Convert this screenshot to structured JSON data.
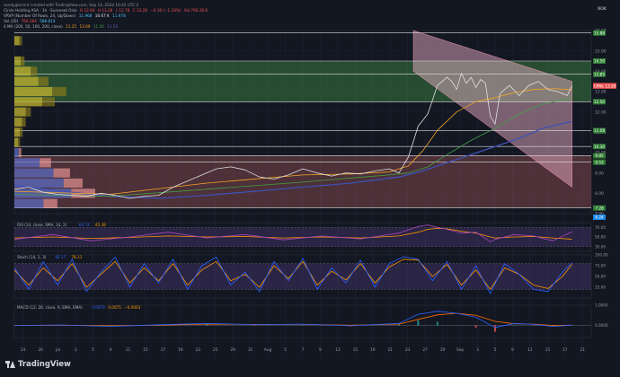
{
  "header": {
    "byline": "sandyglennnt created with TradingView.com, Sep 14, 2024 16:42 UTC-2",
    "lines": [
      {
        "name": "Circle Holding ASA · 1h · Euronext Oslo",
        "vals": [
          "O 12.84",
          "H 13.28",
          "L 12.78",
          "C 13.28",
          "−0.16 (−1.18%)",
          "Vol 760.28 K"
        ]
      },
      {
        "name": "VRVP (Number Of Rows, 24, Up/Down)",
        "vals": [
          "11.968",
          "16.67 K",
          "11.978"
        ]
      },
      {
        "name": "Vol (20)",
        "vals": [
          "760.284",
          "588.814"
        ]
      },
      {
        "name": "4 MA (200, 50, 100, 200, close)",
        "vals": [
          "11.25",
          "13.09",
          "11.56",
          "11.53"
        ]
      }
    ]
  },
  "colors": {
    "background": "#131722",
    "grid": "#1f2433",
    "up": "#26a69a",
    "down": "#ef5350",
    "green_zone": "#4caf50",
    "red_zone": "#e57373",
    "channel": "#f8bbd0",
    "ma_orange": "#f5a623",
    "ma_green": "#43a047",
    "ma_blue": "#3f51b5",
    "osc_band": "#7e57c2",
    "rsi_line": "#ab47bc",
    "signal": "#ff9800",
    "stoch_k": "#2962ff",
    "macd_line": "#2962ff",
    "macd_signal": "#ff6d00"
  },
  "chart_data": {
    "type": "line",
    "title": "Circle Holding ASA · 1h · Euronext Oslo",
    "symbol": "NOK",
    "last_price": 13.28,
    "last_price_label": "CRNL 13.28",
    "price_axis": {
      "ylim": [
        7.0,
        16.0
      ],
      "ticks": [
        "16.00",
        "15.00",
        "14.00",
        "13.00",
        "12.00",
        "11.00",
        "10.00",
        "9.00",
        "8.00",
        "7.00"
      ],
      "level_labels": [
        "15.88",
        "14.50",
        "13.85",
        "12.50",
        "11.08",
        "10.30",
        "9.85",
        "9.53",
        "7.28"
      ]
    },
    "x_axis": {
      "ticks": [
        "24",
        "26",
        "Jul",
        "3",
        "5",
        "9",
        "11",
        "15",
        "17",
        "19",
        "23",
        "25",
        "29",
        "31",
        "Aug",
        "5",
        "7",
        "9",
        "13",
        "15",
        "19",
        "21",
        "23",
        "27",
        "29",
        "Sep",
        "3",
        "5",
        "9",
        "11",
        "15",
        "17",
        "21"
      ],
      "index_range": [
        0,
        120
      ]
    },
    "green_zone": {
      "low": 12.5,
      "high": 14.5
    },
    "red_zone": {
      "low": 7.3,
      "high": 9.85
    },
    "horizontal_levels": [
      15.88,
      14.5,
      13.85,
      12.5,
      11.08,
      10.3,
      9.85,
      9.53,
      7.28
    ],
    "channel": {
      "upper": [
        {
          "x": 83,
          "y": 16.0
        },
        {
          "x": 116,
          "y": 13.5
        }
      ],
      "lower": [
        {
          "x": 83,
          "y": 14.0
        },
        {
          "x": 116,
          "y": 8.3
        }
      ]
    },
    "series": [
      {
        "name": "Close",
        "x": [
          0,
          3,
          6,
          9,
          12,
          15,
          18,
          21,
          24,
          27,
          30,
          33,
          36,
          39,
          42,
          45,
          48,
          51,
          54,
          57,
          60,
          63,
          66,
          69,
          72,
          75,
          78,
          80,
          82,
          84,
          86,
          88,
          90,
          91,
          92,
          93,
          94,
          95,
          96,
          97,
          98,
          99,
          100,
          101,
          103,
          105,
          107,
          109,
          111,
          113,
          115,
          116
        ],
        "values": [
          8.2,
          8.3,
          8.05,
          7.95,
          7.9,
          7.85,
          8.0,
          7.9,
          7.75,
          7.85,
          7.9,
          8.3,
          8.6,
          8.9,
          9.2,
          9.3,
          9.15,
          8.8,
          8.7,
          8.9,
          9.2,
          9.0,
          8.85,
          9.0,
          8.95,
          9.1,
          9.2,
          9.0,
          9.8,
          11.3,
          11.9,
          13.3,
          13.7,
          13.5,
          13.1,
          13.9,
          13.4,
          13.7,
          13.2,
          13.6,
          13.4,
          11.8,
          11.4,
          12.9,
          13.3,
          12.8,
          13.3,
          13.5,
          13.1,
          13.0,
          12.8,
          13.28
        ]
      },
      {
        "name": "MA 50",
        "x": [
          0,
          20,
          40,
          60,
          70,
          78,
          82,
          85,
          88,
          92,
          96,
          100,
          104,
          108,
          112,
          116
        ],
        "values": [
          8.1,
          7.95,
          8.5,
          8.9,
          8.95,
          9.05,
          9.35,
          10.1,
          11.1,
          12.0,
          12.5,
          12.7,
          12.95,
          13.1,
          13.15,
          13.09
        ]
      },
      {
        "name": "MA 100",
        "x": [
          0,
          20,
          40,
          60,
          70,
          78,
          82,
          86,
          90,
          95,
          100,
          105,
          110,
          116
        ],
        "values": [
          7.95,
          7.85,
          8.2,
          8.55,
          8.75,
          8.9,
          9.0,
          9.3,
          9.9,
          10.6,
          11.2,
          11.9,
          12.4,
          12.7
        ]
      },
      {
        "name": "MA 200",
        "x": [
          0,
          10,
          20,
          30,
          40,
          50,
          60,
          70,
          80,
          85,
          90,
          95,
          100,
          105,
          110,
          116
        ],
        "values": [
          8.4,
          8.1,
          7.85,
          7.75,
          7.9,
          8.1,
          8.3,
          8.5,
          8.8,
          9.1,
          9.5,
          9.9,
          10.3,
          10.7,
          11.2,
          11.53
        ]
      }
    ],
    "volume_profile": {
      "rows": [
        {
          "price": 15.5,
          "up": 8,
          "down": 4
        },
        {
          "price": 14.5,
          "up": 10,
          "down": 6
        },
        {
          "price": 14.0,
          "up": 26,
          "down": 10
        },
        {
          "price": 13.5,
          "up": 38,
          "down": 16
        },
        {
          "price": 13.0,
          "up": 60,
          "down": 22
        },
        {
          "price": 12.5,
          "up": 44,
          "down": 20
        },
        {
          "price": 12.0,
          "up": 18,
          "down": 8
        },
        {
          "price": 11.5,
          "up": 12,
          "down": 6
        },
        {
          "price": 11.0,
          "up": 9,
          "down": 4
        },
        {
          "price": 10.5,
          "up": 6,
          "down": 3
        },
        {
          "price": 10.0,
          "up": 7,
          "down": 4
        },
        {
          "price": 9.5,
          "up": 40,
          "down": 18
        },
        {
          "price": 9.0,
          "up": 62,
          "down": 26
        },
        {
          "price": 8.5,
          "up": 78,
          "down": 30
        },
        {
          "price": 8.0,
          "up": 90,
          "down": 38
        },
        {
          "price": 7.5,
          "up": 46,
          "down": 22
        }
      ]
    },
    "volume_label": "6.24",
    "panels": [
      {
        "name": "RSI",
        "header": "RSI (14, close, SMA, 14, 2)",
        "vals": [
          "60.74",
          "45.38"
        ],
        "ticks": [
          "70.00",
          "50.00",
          "30.00"
        ],
        "ylim": [
          20,
          80
        ],
        "band": [
          30,
          70
        ],
        "x": [
          0,
          8,
          16,
          24,
          32,
          40,
          48,
          56,
          64,
          72,
          80,
          84,
          86,
          88,
          90,
          93,
          96,
          99,
          100,
          104,
          108,
          112,
          116
        ],
        "values": [
          45,
          55,
          42,
          50,
          60,
          48,
          55,
          44,
          52,
          46,
          58,
          72,
          75,
          70,
          66,
          58,
          60,
          40,
          45,
          55,
          52,
          42,
          60.74
        ],
        "signal": [
          48,
          50,
          47,
          49,
          52,
          50,
          51,
          48,
          50,
          48,
          52,
          60,
          66,
          68,
          67,
          62,
          58,
          50,
          48,
          50,
          51,
          48,
          45.38
        ]
      },
      {
        "name": "Stoch",
        "header": "Stoch (14, 1, 3)",
        "vals": [
          "82.17",
          "78.11"
        ],
        "ticks": [
          "100.00",
          "75.00",
          "50.00",
          "25.00"
        ],
        "ylim": [
          0,
          100
        ],
        "band": [
          20,
          80
        ],
        "x": [
          0,
          3,
          6,
          9,
          12,
          15,
          18,
          21,
          24,
          27,
          30,
          33,
          36,
          39,
          42,
          45,
          48,
          51,
          54,
          57,
          60,
          63,
          66,
          69,
          72,
          75,
          78,
          81,
          84,
          87,
          90,
          93,
          96,
          99,
          102,
          105,
          108,
          111,
          114,
          116
        ],
        "values": [
          70,
          20,
          85,
          30,
          90,
          15,
          60,
          95,
          25,
          80,
          35,
          90,
          20,
          75,
          95,
          30,
          60,
          15,
          85,
          40,
          92,
          20,
          70,
          35,
          88,
          25,
          80,
          96,
          90,
          40,
          85,
          20,
          75,
          10,
          80,
          55,
          20,
          15,
          60,
          82.17
        ],
        "signal": [
          65,
          30,
          70,
          40,
          80,
          25,
          55,
          85,
          35,
          70,
          40,
          80,
          30,
          65,
          85,
          40,
          55,
          25,
          75,
          45,
          85,
          30,
          62,
          42,
          80,
          35,
          72,
          90,
          88,
          50,
          78,
          30,
          65,
          20,
          70,
          55,
          30,
          22,
          50,
          78.11
        ]
      },
      {
        "name": "MACD",
        "header": "MACD (12, 26, close, 9, EMA, EMA)",
        "vals": [
          "0.0079",
          "0.0075",
          "−0.0003"
        ],
        "ticks": [
          "1.0000",
          "0.0000"
        ],
        "ylim": [
          -0.6,
          1.0
        ],
        "x": [
          0,
          10,
          20,
          30,
          40,
          50,
          60,
          70,
          80,
          84,
          88,
          92,
          96,
          100,
          104,
          108,
          112,
          116
        ],
        "values": [
          0.0,
          0.02,
          -0.05,
          0.03,
          0.1,
          0.04,
          0.06,
          -0.02,
          0.1,
          0.55,
          0.7,
          0.6,
          0.4,
          -0.1,
          0.1,
          0.05,
          -0.05,
          0.0079
        ],
        "signal": [
          0.0,
          0.01,
          -0.02,
          0.01,
          0.06,
          0.05,
          0.05,
          0.01,
          0.06,
          0.3,
          0.52,
          0.6,
          0.5,
          0.2,
          0.08,
          0.06,
          0.0,
          0.0075
        ]
      }
    ]
  },
  "footer": {
    "brand": "TradingView"
  }
}
